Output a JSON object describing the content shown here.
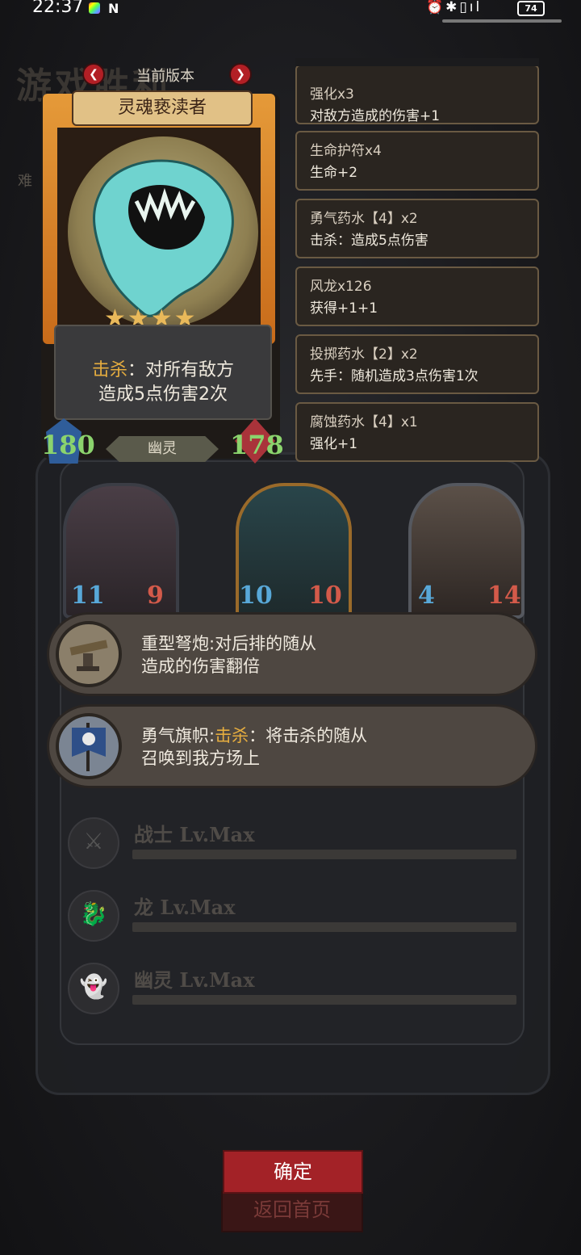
{
  "status_bar": {
    "time": "22:37",
    "battery": "74"
  },
  "background": {
    "title": "游戏胜利",
    "difficulty_label": "难"
  },
  "card": {
    "version_label": "当前版本",
    "name": "灵魂亵渎者",
    "stars": "★★★★",
    "desc_keyword": "击杀",
    "desc_line1_rest": "：对所有敌方",
    "desc_line2": "造成5点伤害2次",
    "attack": "180",
    "health": "178",
    "tribe": "幽灵"
  },
  "items": [
    {
      "title": "强化x3",
      "effect": "对敌方造成的伤害+1"
    },
    {
      "title": "生命护符x4",
      "effect": "生命+2"
    },
    {
      "title": "勇气药水【4】x2",
      "effect": "击杀：造成5点伤害"
    },
    {
      "title": "风龙x126",
      "effect": "获得+1+1"
    },
    {
      "title": "投掷药水【2】x2",
      "effect": "先手：随机造成3点伤害1次"
    },
    {
      "title": "腐蚀药水【4】x1",
      "effect": "强化+1"
    }
  ],
  "minions": [
    {
      "attack": "11",
      "health": "9"
    },
    {
      "attack": "10",
      "health": "10"
    },
    {
      "attack": "4",
      "health": "14"
    }
  ],
  "bonuses": [
    {
      "name": "重型弩炮:",
      "text1": "对后排的随从",
      "text2": "造成的伤害翻倍"
    },
    {
      "name": "勇气旗帜:",
      "keyword": "击杀",
      "text1": "：将击杀的随从",
      "text2": "召唤到我方场上"
    }
  ],
  "levels": [
    {
      "label": "战士 Lv.Max"
    },
    {
      "label": "龙 Lv.Max"
    },
    {
      "label": "幽灵 Lv.Max"
    }
  ],
  "buttons": {
    "confirm": "确定",
    "home": "返回首页"
  },
  "colors": {
    "keyword": "#e6ad3f",
    "stat_green": "#8bd36d",
    "confirm_red": "#a32227"
  }
}
